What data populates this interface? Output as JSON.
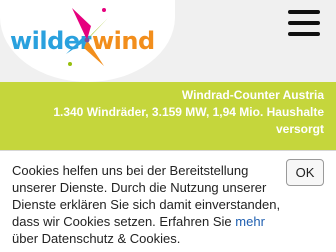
{
  "logo": {
    "word_left": "wilder",
    "word_right": "wind",
    "icon": "pinwheel-icon",
    "colors": {
      "left": "#2aa1de",
      "right": "#f28e1c",
      "pinwheel": [
        "#e6007e",
        "#97bf0d",
        "#f28e1c",
        "#2aa1de",
        "#7a4e9c"
      ]
    }
  },
  "header": {
    "menu_icon": "hamburger-menu-icon"
  },
  "banner": {
    "title": "Windrad-Counter Austria",
    "stats_line": "1.340 Windräder, 3.159 MW, 1,94 Mio. Haushalte",
    "stats_line2": "versorgt",
    "background": "#c5d63c"
  },
  "cookie": {
    "text_before": "Cookies helfen uns bei der Bereitstellung unserer Dienste. Durch die Nutzung unserer Dienste erklären Sie sich damit einverstanden, dass wir Cookies setzen. Erfahren Sie ",
    "link": "mehr",
    "text_after": " über Datenschutz & Cookies.",
    "ok_label": "OK"
  }
}
